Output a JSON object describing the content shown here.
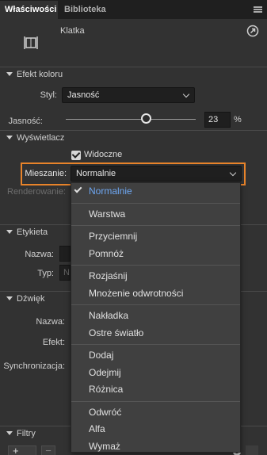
{
  "tabs": [
    {
      "label": "Właściwości",
      "active": true
    },
    {
      "label": "Biblioteka",
      "active": false
    }
  ],
  "header": {
    "object_type": "Klatka"
  },
  "color_effect": {
    "title": "Efekt koloru",
    "style_label": "Styl:",
    "style_value": "Jasność",
    "brightness_label": "Jasność:",
    "brightness_value": "23",
    "brightness_unit": "%",
    "brightness_level": 0.615
  },
  "display": {
    "title": "Wyświetlacz",
    "visible_label": "Widoczne",
    "visible_checked": true,
    "blend_label": "Mieszanie:",
    "blend_value": "Normalnie",
    "render_label": "Renderowanie:"
  },
  "label_section": {
    "title": "Etykieta",
    "name_label": "Nazwa:",
    "type_label": "Typ:",
    "type_value_partial": "N"
  },
  "sound_section": {
    "title": "Dźwięk",
    "name_label": "Nazwa:",
    "effect_label": "Efekt:",
    "sync_label": "Synchronizacja:"
  },
  "filters_section": {
    "title": "Filtry",
    "add_glyph": "+",
    "remove_glyph": "−"
  },
  "blend_menu": {
    "selected": "Normalnie",
    "groups": [
      [
        "Normalnie"
      ],
      [
        "Warstwa"
      ],
      [
        "Przyciemnij",
        "Pomnóż"
      ],
      [
        "Rozjaśnij",
        "Mnożenie odwrotności"
      ],
      [
        "Nakładka",
        "Ostre światło"
      ],
      [
        "Dodaj",
        "Odejmij",
        "Różnica"
      ],
      [
        "Odwróć",
        "Alfa",
        "Wymaż"
      ]
    ]
  },
  "colors": {
    "accent_focus": "#e8832a",
    "selected_item": "#6ea7f2"
  }
}
